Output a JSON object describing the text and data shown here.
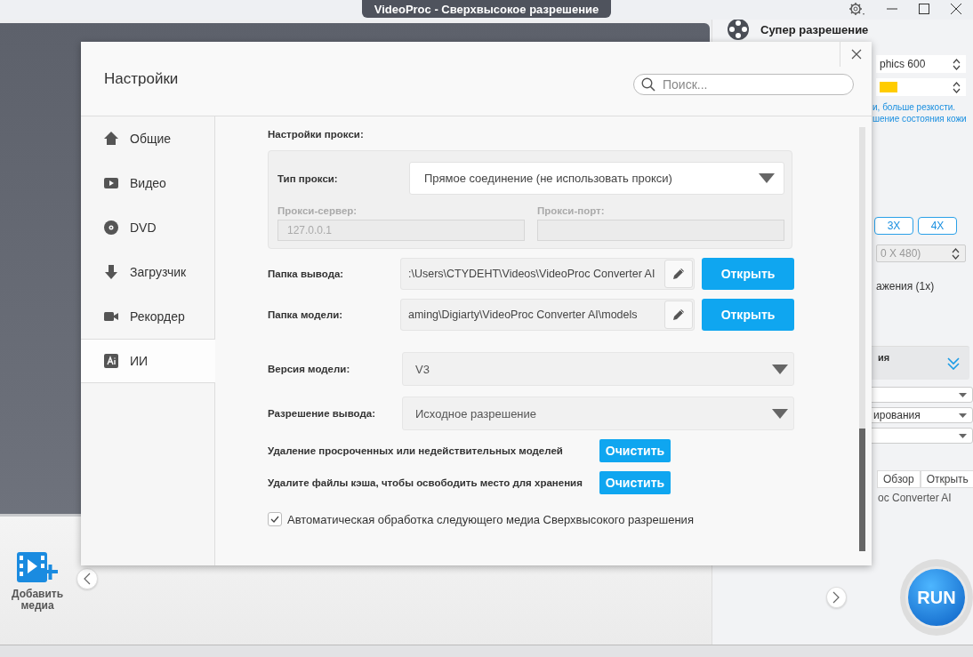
{
  "window": {
    "title": "VideoProc - Сверхвысокое разрешение"
  },
  "side_panel": {
    "title": "Супер разрешение",
    "gpu_select": "phics 600",
    "description": [
      "и, больше резкости.",
      "шение состояния кожи"
    ],
    "scale_buttons": [
      "3X",
      "4X"
    ],
    "resolution_select": {
      "value": "0 X 480)",
      "disabled": true
    },
    "scale_note": "ажения (1x)",
    "section": {
      "title": "ия",
      "expanded": false
    },
    "dropdowns": [
      {
        "kind": "dropdown"
      },
      {
        "kind": "dropdown",
        "value": "ирования"
      },
      {
        "kind": "dropdown"
      }
    ],
    "folder_buttons": [
      "Обзор",
      "Открыть"
    ],
    "folder_path": "ос Converter AI",
    "run_button": "RUN"
  },
  "bottom_bar": {
    "add_media": "Добавить медиа"
  },
  "settings_dialog": {
    "title": "Настройки",
    "search": {
      "placeholder": "Поиск..."
    },
    "sidebar": [
      {
        "label": "Общие",
        "kind": "home",
        "selected": false
      },
      {
        "label": "Видео",
        "kind": "video",
        "selected": false
      },
      {
        "label": "DVD",
        "kind": "dvd",
        "selected": false
      },
      {
        "label": "Загрузчик",
        "kind": "download",
        "selected": false
      },
      {
        "label": "Рекордер",
        "kind": "recorder",
        "selected": false
      },
      {
        "label": "ИИ",
        "kind": "ai",
        "selected": true
      }
    ],
    "proxy": {
      "heading": "Настройки прокси:",
      "type_label": "Тип прокси:",
      "type_value": "Прямое соединение (не использовать прокси)",
      "server": {
        "label": "Прокси-сервер:",
        "value": "127.0.0.1",
        "disabled": true
      },
      "port": {
        "label": "Прокси-порт:",
        "disabled": true
      }
    },
    "folders": [
      {
        "label": "Папка вывода:",
        "path": ":\\Users\\CTYDEHT\\Videos\\VideoProc Converter AI",
        "button": "Открыть"
      },
      {
        "label": "Папка модели:",
        "path": "aming\\Digiarty\\VideoProc Converter AI\\models",
        "button": "Открыть"
      }
    ],
    "selects": [
      {
        "label": "Версия модели:",
        "value": "V3"
      },
      {
        "label": "Разрешение вывода:",
        "value": "Исходное разрешение"
      }
    ],
    "actions": [
      {
        "label": "Удаление просроченных или недействительных моделей",
        "button": "Очистить"
      },
      {
        "label": "Удалите файлы кэша, чтобы освободить место для хранения",
        "button": "Очистить"
      }
    ],
    "auto_process": {
      "label": "Автоматическая обработка следующего медиа Сверхвысокого разрешения",
      "checked": true
    }
  }
}
